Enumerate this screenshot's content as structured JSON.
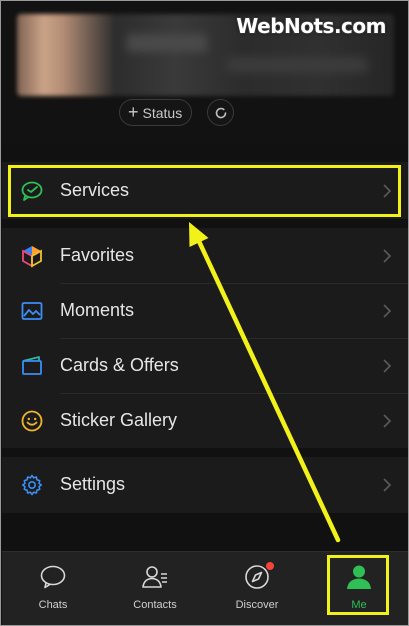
{
  "watermark": "WebNots.com",
  "profile": {
    "status_label": "Status"
  },
  "menu": {
    "services": "Services",
    "favorites": "Favorites",
    "moments": "Moments",
    "cards_offers": "Cards & Offers",
    "sticker_gallery": "Sticker Gallery",
    "settings": "Settings"
  },
  "tabs": [
    {
      "label": "Chats",
      "icon": "chat-bubble-icon"
    },
    {
      "label": "Contacts",
      "icon": "contacts-icon"
    },
    {
      "label": "Discover",
      "icon": "compass-icon"
    },
    {
      "label": "Me",
      "icon": "person-icon"
    }
  ],
  "colors": {
    "accent": "#2fbf55",
    "highlight": "#f2f21a",
    "background": "#111111",
    "badge": "#f5453a"
  }
}
